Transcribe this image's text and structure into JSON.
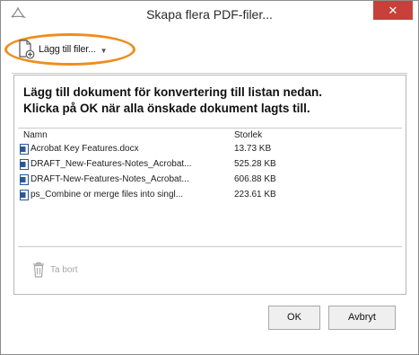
{
  "window": {
    "title": "Skapa flera PDF-filer...",
    "close_symbol": "✕",
    "app_icon": "adobe-acrobat-icon"
  },
  "toolbar": {
    "add_files_label": "Lägg till filer...",
    "add_files_icon": "add-document-icon",
    "dropdown_icon": "caret-down-icon",
    "highlight_color": "#f08c1c"
  },
  "instructions": {
    "line1": "Lägg till dokument för konvertering till listan nedan.",
    "line2": "Klicka på OK när alla önskade dokument lagts till."
  },
  "file_list": {
    "columns": [
      "Namn",
      "Storlek"
    ],
    "rows": [
      {
        "name": "Acrobat Key Features.docx",
        "size": "13.73 KB"
      },
      {
        "name": "DRAFT_New-Features-Notes_Acrobat...",
        "size": "525.28 KB"
      },
      {
        "name": "DRAFT-New-Features-Notes_Acrobat...",
        "size": "606.88 KB"
      },
      {
        "name": "ps_Combine or merge files into singl...",
        "size": "223.61 KB"
      }
    ]
  },
  "actions": {
    "delete_label": "Ta bort",
    "delete_icon": "trash-icon",
    "ok_label": "OK",
    "cancel_label": "Avbryt"
  }
}
